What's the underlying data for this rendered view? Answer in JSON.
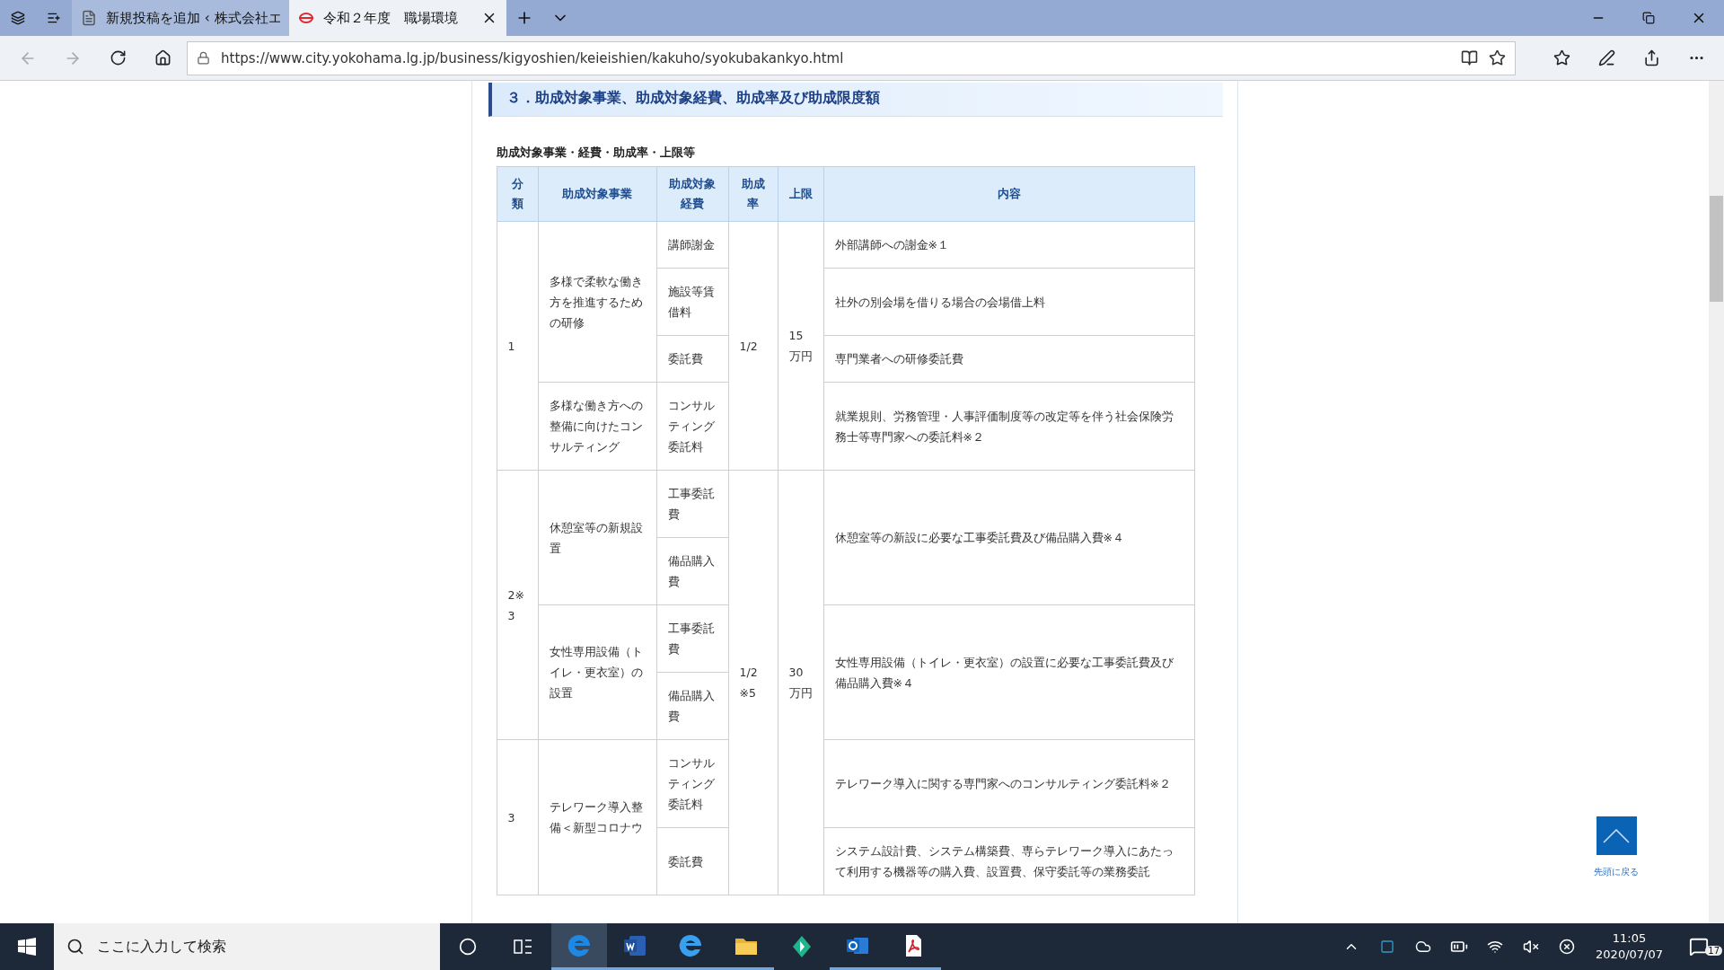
{
  "browser": {
    "tabs": [
      {
        "title": "新規投稿を追加 ‹ 株式会社エ",
        "selected": false
      },
      {
        "title": "令和２年度　職場環境",
        "selected": true
      }
    ],
    "url": "https://www.city.yokohama.lg.jp/business/kigyoshien/keieishien/kakuho/syokubakankyo.html"
  },
  "page": {
    "heading": "３．助成対象事業、助成対象経費、助成率及び助成限度額",
    "table_caption": "助成対象事業・経費・助成率・上限等",
    "table": {
      "columns": [
        "分類",
        "助成対象事業",
        "助成対象経費",
        "助成率",
        "上限",
        "内容"
      ],
      "rate_groups": [
        {
          "rate": "1/2",
          "limit": "15万円",
          "categories": [
            {
              "category": "1",
              "projects": [
                {
                  "name": "多様で柔軟な働き方を推進するための研修",
                  "expenses": [
                    {
                      "name": "講師謝金",
                      "content": "外部講師への謝金※１"
                    },
                    {
                      "name": "施設等賃借料",
                      "content": "社外の別会場を借りる場合の会場借上料"
                    },
                    {
                      "name": "委託費",
                      "content": "専門業者への研修委託費"
                    }
                  ]
                },
                {
                  "name": "多様な働き方への整備に向けたコンサルティング",
                  "expenses": [
                    {
                      "name": "コンサルティング委託料",
                      "content": "就業規則、労務管理・人事評価制度等の改定等を伴う社会保険労務士等専門家への委託料※２"
                    }
                  ]
                }
              ]
            }
          ]
        },
        {
          "rate": "1/2※5",
          "limit": "30万円",
          "categories": [
            {
              "category": "2※3",
              "projects": [
                {
                  "name": "休憩室等の新規設置",
                  "content": "休憩室等の新設に必要な工事委託費及び備品購入費※４",
                  "expenses": [
                    {
                      "name": "工事委託費"
                    },
                    {
                      "name": "備品購入費"
                    }
                  ]
                },
                {
                  "name": "女性専用設備（トイレ・更衣室）の設置",
                  "content": "女性専用設備（トイレ・更衣室）の設置に必要な工事委託費及び備品購入費※４",
                  "expenses": [
                    {
                      "name": "工事委託費"
                    },
                    {
                      "name": "備品購入費"
                    }
                  ]
                }
              ]
            },
            {
              "category": "3",
              "projects": [
                {
                  "name": "テレワーク導入整備＜新型コロナウ",
                  "expenses": [
                    {
                      "name": "コンサルティング委託料",
                      "content": "テレワーク導入に関する専門家へのコンサルティング委託料※２"
                    },
                    {
                      "name": "委託費",
                      "content": "システム設計費、システム構築費、専らテレワーク導入にあたって利用する機器等の購入費、設置費、保守委託等の業務委託"
                    }
                  ]
                }
              ]
            }
          ]
        }
      ]
    },
    "back_to_top": "先頭に戻る"
  },
  "taskbar": {
    "search_placeholder": "ここに入力して検索",
    "time": "11:05",
    "date": "2020/07/07",
    "notification_count": "17"
  }
}
